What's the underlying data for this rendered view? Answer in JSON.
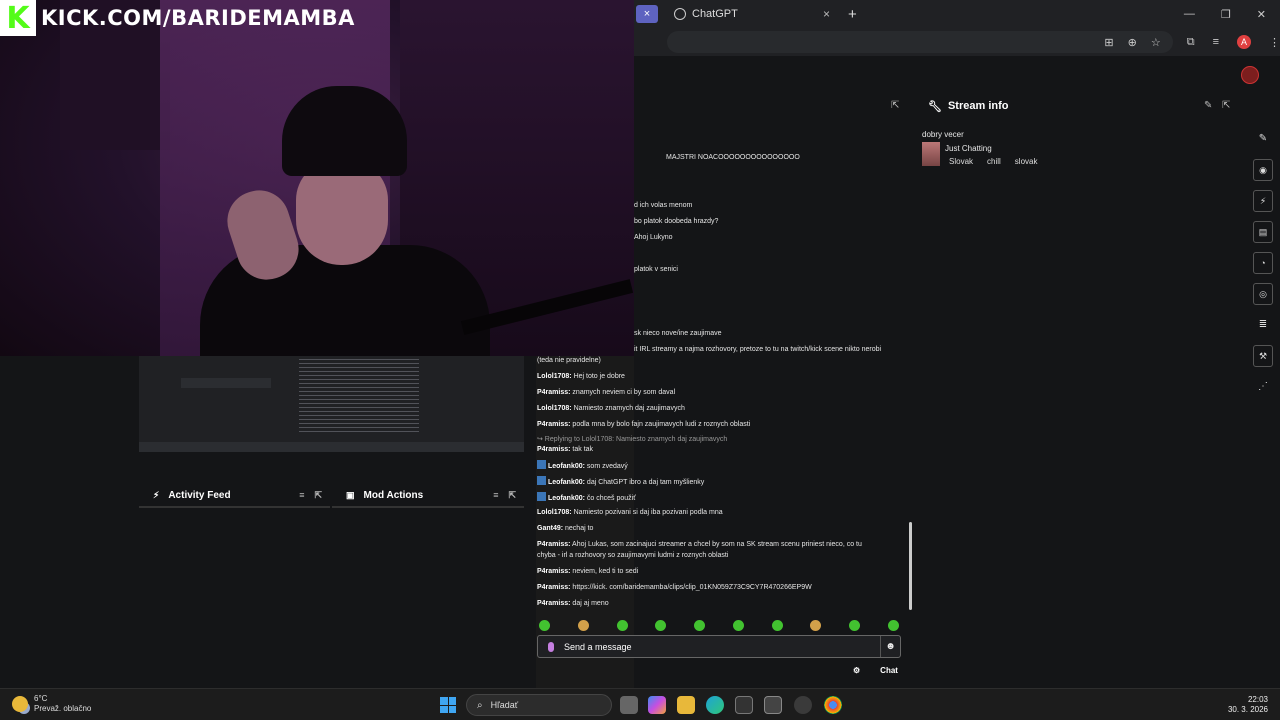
{
  "overlay": {
    "logo_letter": "K",
    "channel_url": "KICK.COM/BARIDEMAMBA"
  },
  "browser": {
    "tab_title": "ChatGPT",
    "tab_close": "×",
    "new_tab": "+",
    "window_controls": [
      "—",
      "❐",
      "✕"
    ],
    "profile_initial": "A"
  },
  "stream_info": {
    "title": "Stream info",
    "stream_title": "dobry vecer",
    "category": "Just Chatting",
    "tags": [
      "Slovak",
      "chill",
      "slovak"
    ]
  },
  "chat": {
    "messages": [
      {
        "user": "",
        "text": "MAJSTRI NOACOOOOOOOOOOOOOOO"
      },
      {
        "user": "",
        "text": "d ich volas menom"
      },
      {
        "user": "",
        "text": "bo platok doobeda hrazdy?"
      },
      {
        "user": "",
        "text": "Ahoj Lukyno"
      },
      {
        "user": "",
        "text": "platok v senici"
      },
      {
        "user": "",
        "text": "sk nieco nove/ine zaujimave"
      },
      {
        "user": "",
        "text": "it IRL streamy a najma rozhovory, pretoze to tu na twitch/kick scene nikto nerobi"
      },
      {
        "user": "",
        "text": "(teda nie pravidelne)"
      },
      {
        "user": "Lolol1708:",
        "text": "Hej toto je dobre"
      },
      {
        "user": "P4ramiss:",
        "text": "znamych neviem ci by som daval"
      },
      {
        "user": "Lolol1708:",
        "text": "Namiesto znamych daj zaujimavych"
      },
      {
        "user": "P4ramiss:",
        "text": "podla mna by bolo fajn zaujimavych ludi z roznych oblasti"
      },
      {
        "user": "",
        "text": "↪ Replying to Lolol1708: Namiesto znamych daj zaujimavych"
      },
      {
        "user": "P4ramiss:",
        "text": "tak tak"
      },
      {
        "user": "Leofank00:",
        "text": "som zvedavý"
      },
      {
        "user": "Leofank00:",
        "text": "daj ChatGPT ibro a daj tam myšlienky"
      },
      {
        "user": "Leofank00:",
        "text": "čo chceš použiť"
      },
      {
        "user": "Lolol1708:",
        "text": "Namiesto pozivani si daj iba pozivani podla mna"
      },
      {
        "user": "Gant49:",
        "text": "nechaj to"
      },
      {
        "user": "P4ramiss:",
        "text": "Ahoj Lukas, som zacinajuci streamer a chcel by som na SK stream scenu priniest nieco, co tu"
      },
      {
        "user": "",
        "text": "chyba - irl a rozhovory so zaujimavymi ludmi z roznych oblasti"
      },
      {
        "user": "P4ramiss:",
        "text": "neviem, ked ti to sedi"
      },
      {
        "user": "P4ramiss:",
        "text": "https://kick. com/baridemamba/clips/clip_01KN059Z73C9CY7R470266EP9W"
      },
      {
        "user": "P4ramiss:",
        "text": "daj aj meno"
      }
    ],
    "input_placeholder": "Send a message",
    "send_label": "Chat"
  },
  "panels": {
    "activity_feed": "Activity Feed",
    "mod_actions": "Mod Actions"
  },
  "taskbar": {
    "temperature": "6°C",
    "weather": "Prevaž. oblačno",
    "search_label": "Hľadať",
    "time": "22:03",
    "date": "30. 3. 2026"
  },
  "colors": {
    "kick_green": "#53fc18",
    "chat_bg": "#141517"
  }
}
